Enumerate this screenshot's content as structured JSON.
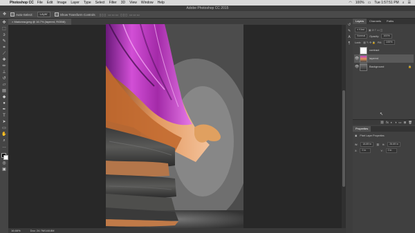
{
  "menubar": {
    "app_name": "Photoshop CC",
    "items": [
      "File",
      "Edit",
      "Image",
      "Layer",
      "Type",
      "Select",
      "Filter",
      "3D",
      "View",
      "Window",
      "Help"
    ],
    "battery": "100%",
    "clock": "Tue 1:57:51 PM"
  },
  "window": {
    "title": "Adobe Photoshop CC 2015"
  },
  "options": {
    "auto_select_label": "Auto-Select:",
    "auto_select_value": "Layer",
    "transform_label": "Show Transform Controls"
  },
  "document": {
    "tab_title": "Madonna.jpeg @ 16.7% (layered, RGB/8)"
  },
  "status": {
    "zoom": "16.66%",
    "doc": "Doc: 24.7M/148.8M"
  },
  "layers_panel": {
    "tabs": [
      "Layers",
      "Channels",
      "Paths"
    ],
    "filter_label": "Kind",
    "blend_mode": "Normal",
    "opacity_label": "Opacity:",
    "opacity_value": "100%",
    "lock_label": "Lock:",
    "fill_label": "Fill:",
    "fill_value": "100%",
    "layers": [
      {
        "name": "contract",
        "visible": false,
        "selected": false
      },
      {
        "name": "layered",
        "visible": true,
        "selected": true
      },
      {
        "name": "Background",
        "visible": true,
        "selected": false
      }
    ]
  },
  "properties_panel": {
    "tab": "Properties",
    "title": "Pixel Layer Properties",
    "w_label": "W:",
    "w_value": "18.89 in",
    "h_label": "H:",
    "h_value": "26.69 in",
    "x_label": "X:",
    "x_value": "0 in",
    "y_label": "Y:",
    "y_value": "0 in"
  },
  "colors": {
    "ui_dark": "#282828",
    "panel": "#404040",
    "accent_magenta": "#c23fc6",
    "accent_orange": "#e0935a"
  }
}
